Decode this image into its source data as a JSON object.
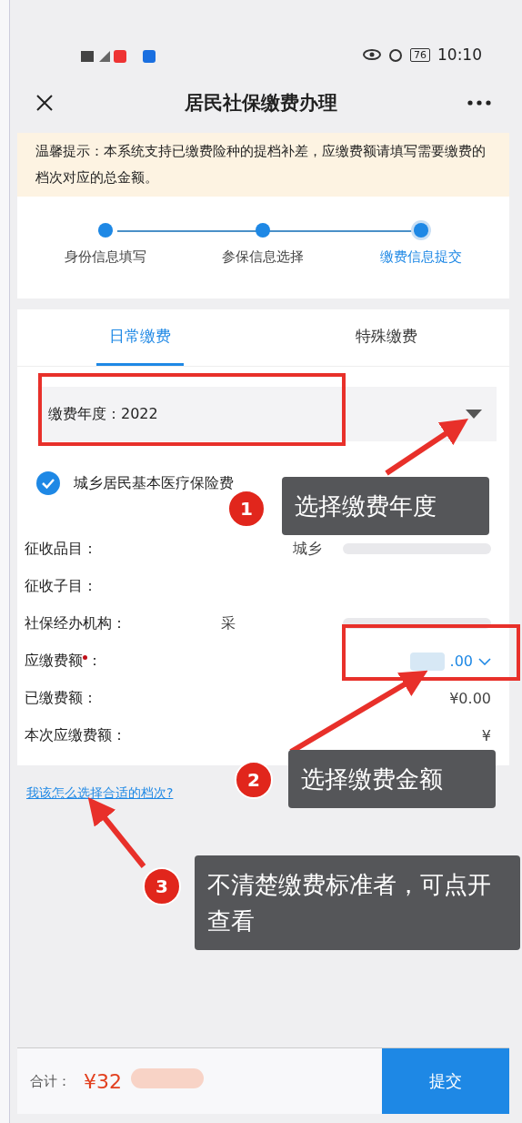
{
  "status_bar": {
    "time": "10:10",
    "battery": "76"
  },
  "header": {
    "title": "居民社保缴费办理"
  },
  "notice": {
    "text": "温馨提示：本系统支持已缴费险种的提档补差，应缴费额请填写需要缴费的档次对应的总金额。"
  },
  "steps": [
    {
      "label": "身份信息填写",
      "selected": false
    },
    {
      "label": "参保信息选择",
      "selected": false
    },
    {
      "label": "缴费信息提交",
      "selected": true
    }
  ],
  "tabs": [
    {
      "label": "日常缴费",
      "selected": true
    },
    {
      "label": "特殊缴费",
      "selected": false
    }
  ],
  "year_select": {
    "label": "缴费年度：",
    "value": "2022"
  },
  "insurance_checkbox": {
    "label": "城乡居民基本医疗保险费",
    "checked": true
  },
  "rows": [
    {
      "label": "征收品目：",
      "value": "城乡",
      "required": false,
      "kind": "text"
    },
    {
      "label": "征收子目：",
      "required": false,
      "kind": "text"
    },
    {
      "label": "社保经办机构：",
      "value": "采",
      "required": false,
      "kind": "text"
    },
    {
      "label": "应缴费额",
      "suffix": "：",
      "value": ".00",
      "required": true,
      "kind": "dropdown"
    },
    {
      "label": "已缴费额：",
      "value": "¥0.00",
      "required": false,
      "kind": "text"
    },
    {
      "label": "本次应缴费额：",
      "value": "¥",
      "required": false,
      "kind": "text"
    }
  ],
  "help_link": "我该怎么选择合适的档次?",
  "footer": {
    "total_label": "合计：",
    "total_value": "¥32",
    "submit": "提交"
  },
  "annotations": [
    {
      "number": "1",
      "text": "选择缴费年度"
    },
    {
      "number": "2",
      "text": "选择缴费金额"
    },
    {
      "number": "3",
      "text": "不清楚缴费标准者，可点开查看"
    }
  ]
}
